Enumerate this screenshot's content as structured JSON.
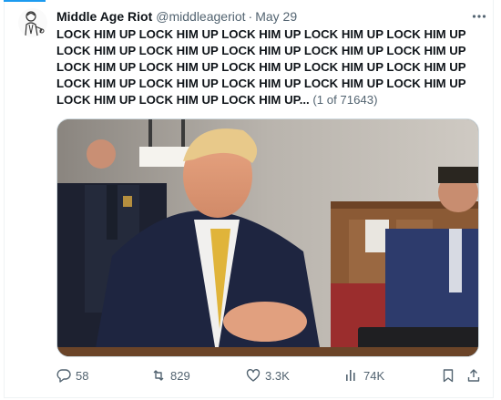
{
  "tweet": {
    "display_name": "Middle Age Riot",
    "handle": "@middleageriot",
    "separator": "·",
    "date": "May 29",
    "text": "LOCK HIM UP LOCK HIM UP LOCK HIM UP LOCK HIM UP LOCK HIM UP LOCK HIM UP LOCK HIM UP LOCK HIM UP LOCK HIM UP LOCK HIM UP LOCK HIM UP LOCK HIM UP LOCK HIM UP LOCK HIM UP LOCK HIM UP LOCK HIM UP LOCK HIM UP LOCK HIM UP LOCK HIM UP LOCK HIM UP LOCK HIM UP LOCK HIM UP LOCK HIM UP...",
    "thread_count": "(1 of 71643)",
    "media_icon": "courtroom-photo"
  },
  "actions": {
    "replies": "58",
    "reposts": "829",
    "likes": "3.3K",
    "views": "74K"
  },
  "colors": {
    "accent": "#1d9bf0",
    "text": "#0f1419",
    "secondary": "#536471"
  }
}
